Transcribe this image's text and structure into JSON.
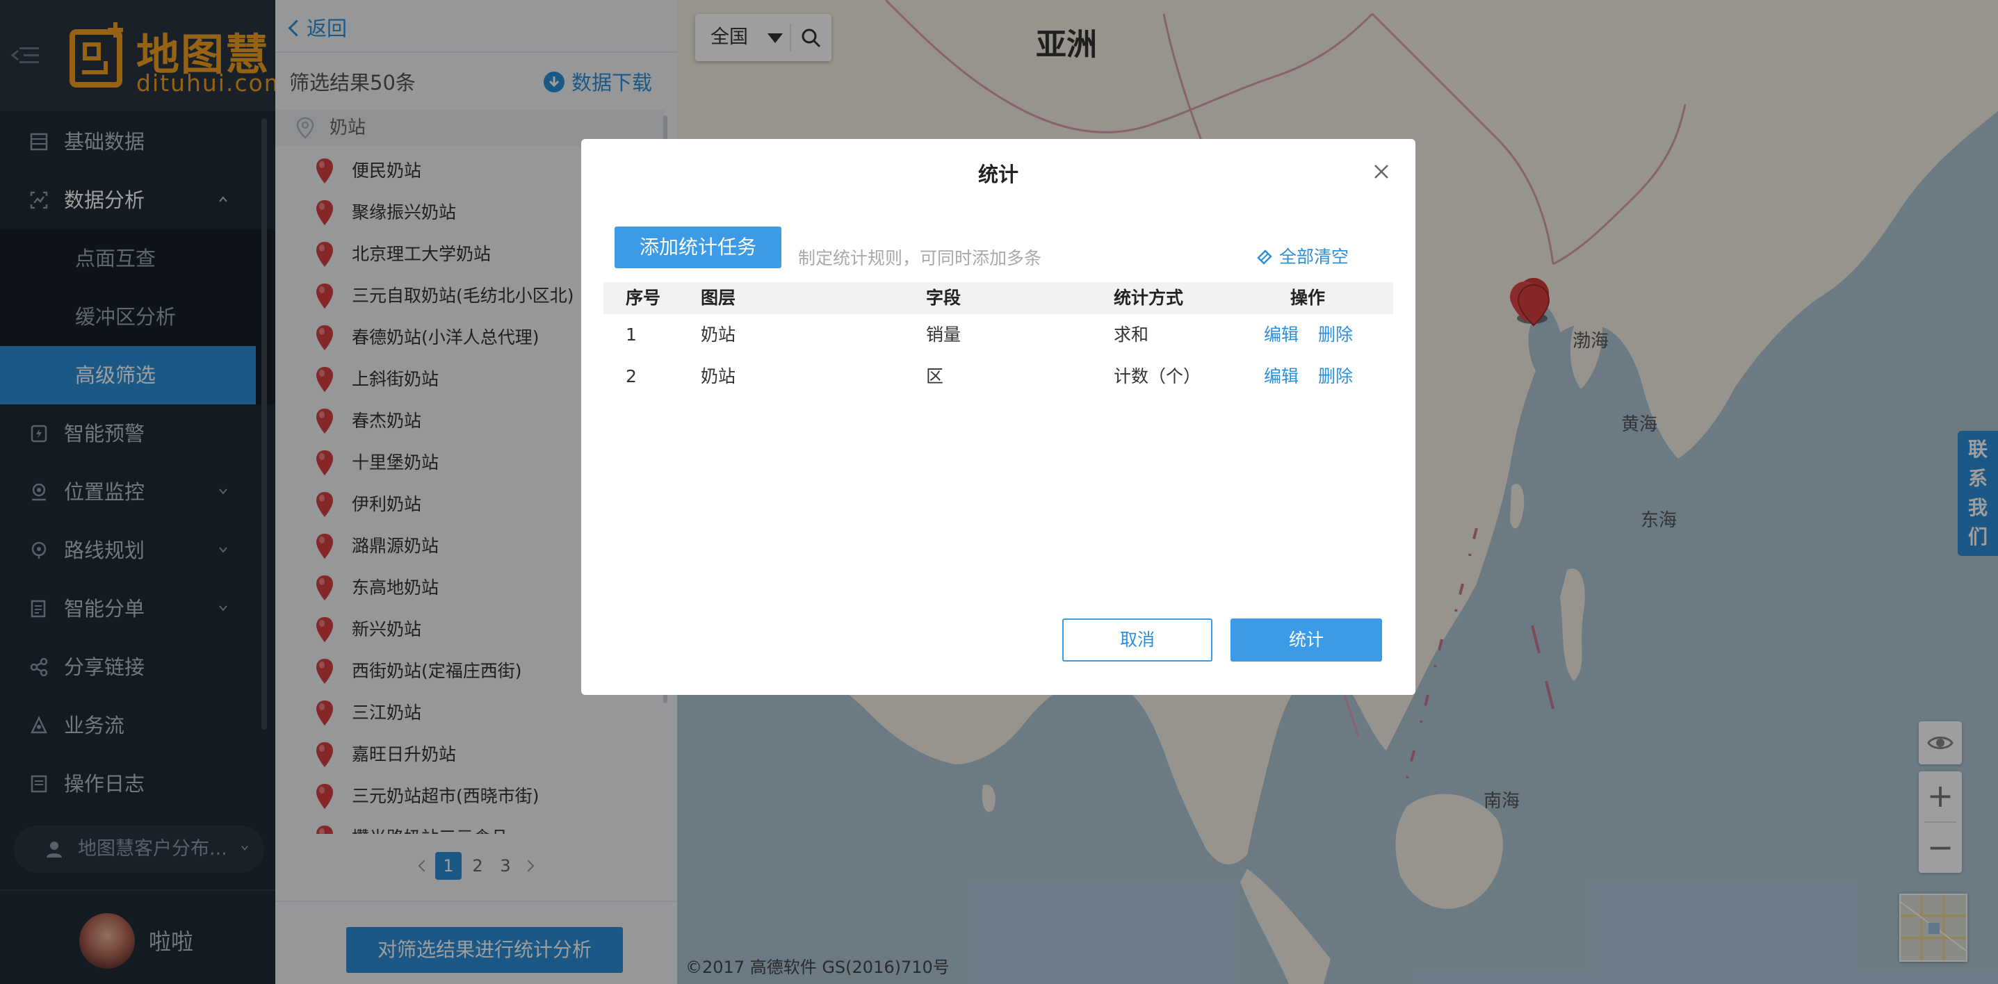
{
  "brand": {
    "title": "地图慧",
    "subtitle": "dituhui.com",
    "color": "#f0a020"
  },
  "sidebar": {
    "items": [
      {
        "label": "基础数据",
        "icon": "database-icon"
      },
      {
        "label": "数据分析",
        "icon": "analysis-icon",
        "expanded": true
      },
      {
        "label": "智能预警",
        "icon": "alert-icon"
      },
      {
        "label": "位置监控",
        "icon": "location-icon",
        "has_children": true
      },
      {
        "label": "路线规划",
        "icon": "route-icon",
        "has_children": true
      },
      {
        "label": "智能分单",
        "icon": "dispatch-icon",
        "has_children": true
      },
      {
        "label": "分享链接",
        "icon": "share-icon"
      },
      {
        "label": "业务流",
        "icon": "workflow-icon"
      },
      {
        "label": "操作日志",
        "icon": "log-icon"
      }
    ],
    "sub_items": [
      {
        "label": "点面互查"
      },
      {
        "label": "缓冲区分析"
      },
      {
        "label": "高级筛选",
        "active": true
      }
    ],
    "customer": "地图慧客户分布...",
    "username": "啦啦",
    "active_color": "#2d8fd8"
  },
  "panel": {
    "back": "返回",
    "result_count": "筛选结果50条",
    "download": "数据下载",
    "category": "奶站",
    "stations": [
      "便民奶站",
      "聚缘振兴奶站",
      "北京理工大学奶站",
      "三元自取奶站(毛纺北小区北)",
      "春德奶站(小洋人总代理)",
      "上斜街奶站",
      "春杰奶站",
      "十里堡奶站",
      "伊利奶站",
      "潞鼎源奶站",
      "东高地奶站",
      "新兴奶站",
      "西街奶站(定福庄西街)",
      "三江奶站",
      "嘉旺日升奶站",
      "三元奶站超市(西晓市街)",
      "攒光路奶站三元食品"
    ],
    "pages": [
      "1",
      "2",
      "3"
    ],
    "current_page": "1",
    "analyze_button": "对筛选结果进行统计分析"
  },
  "map": {
    "region": "全国",
    "labels": {
      "asia": "亚洲",
      "bohai": "渤海",
      "yellow_sea": "黄海",
      "east_sea": "东海",
      "south_sea": "南海"
    },
    "contact": [
      "联",
      "系",
      "我",
      "们"
    ],
    "copyright": "©2017 高德软件 GS(2016)710号",
    "zoom_in": "+",
    "zoom_out": "−"
  },
  "dialog": {
    "title": "统计",
    "add_task": "添加统计任务",
    "hint": "制定统计规则，可同时添加多条",
    "clear_all": "全部清空",
    "columns": [
      "序号",
      "图层",
      "字段",
      "统计方式",
      "操作"
    ],
    "rows": [
      {
        "index": "1",
        "layer": "奶站",
        "field": "销量",
        "method": "求和",
        "edit": "编辑",
        "delete": "删除"
      },
      {
        "index": "2",
        "layer": "奶站",
        "field": "区",
        "method": "计数（个）",
        "edit": "编辑",
        "delete": "删除"
      }
    ],
    "cancel": "取消",
    "confirm": "统计"
  }
}
